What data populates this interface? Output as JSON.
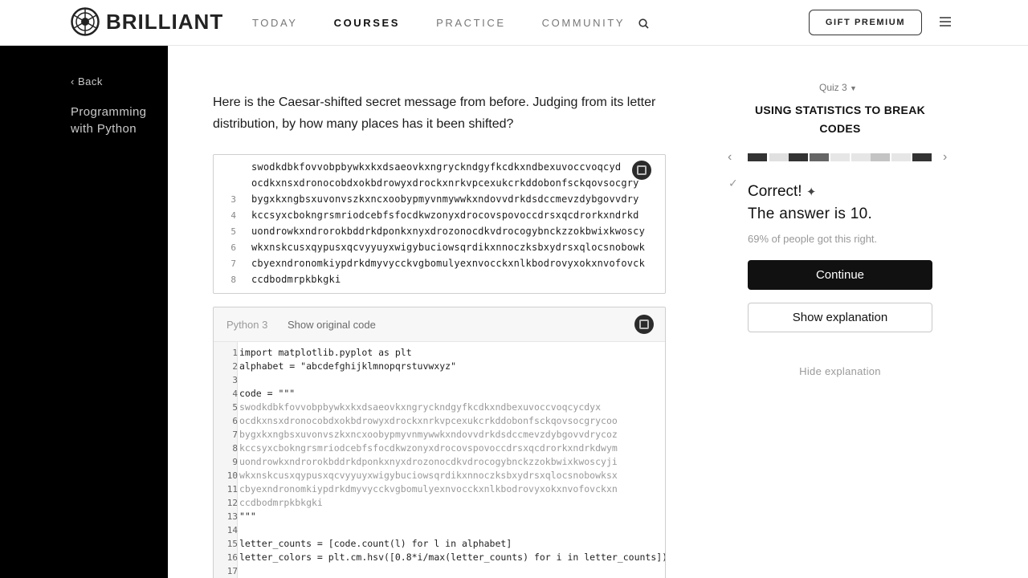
{
  "header": {
    "brand": "BRILLIANT",
    "nav": [
      "TODAY",
      "COURSES",
      "PRACTICE",
      "COMMUNITY"
    ],
    "active_nav": "COURSES",
    "search_placeholder": "",
    "gift_label": "GIFT PREMIUM",
    "icons": [
      "brilliant-logo-icon",
      "search-icon",
      "menu-icon"
    ]
  },
  "sidebar": {
    "back_label": "Back",
    "course_title": "Programming with Python"
  },
  "question": {
    "text": "Here is the Caesar-shifted secret message from before. Judging from its letter distribution, by how many places has it been shifted?"
  },
  "message_panel": {
    "lines": [
      {
        "n": "",
        "t": "swodkdbkfovvobpbywkxkxdsaeovkxngryckndgyfkcdkxndbexuvoccvoqcyd"
      },
      {
        "n": "",
        "t": "ocdkxnsxdronocobdxokbdrowyxdrockxnrkvpcexukcrkddobonfsckqovsocgry"
      },
      {
        "n": "3",
        "t": "bygxkxngbsxuvonvszkxncxoobypmyvnmywwkxndovvdrkdsdccmevzdybgovvdry"
      },
      {
        "n": "4",
        "t": "kccsyxcbokngrsmriodcebfsfocdkwzonyxdrocovspovoccdrsxqcdrorkxndrkd"
      },
      {
        "n": "5",
        "t": "uondrowkxndrorokbddrkdponkxnyxdrozonocdkvdrocogybnckzzokbwixkwoscy"
      },
      {
        "n": "6",
        "t": "wkxnskcusxqypusxqcvyyuyxwigybuciowsqrdikxnnoczksbxydrsxqlocsnobowk"
      },
      {
        "n": "7",
        "t": "cbyexndronomkiypdrkdmyvycckvgbomulyexnvocckxnlkbodrovyxokxnvofovck"
      },
      {
        "n": "8",
        "t": "ccdbodmrpkbkgki"
      }
    ]
  },
  "code_panel": {
    "language": "Python 3",
    "show_original": "Show original code",
    "lines": [
      {
        "n": "1",
        "t": "import matplotlib.pyplot as plt"
      },
      {
        "n": "2",
        "t": "alphabet = \"abcdefghijklmnopqrstuvwxyz\""
      },
      {
        "n": "3",
        "t": ""
      },
      {
        "n": "4",
        "t": "code = \"\"\""
      },
      {
        "n": "5",
        "t": "swodkdbkfovvobpbywkxkxdsaeovkxngryckndgyfkcdkxndbexuvoccvoqcycdyx"
      },
      {
        "n": "6",
        "t": "ocdkxnsxdronocobdxokbdrowyxdrockxnrkvpcexukcrkddobonfsckqovsocgrycoo"
      },
      {
        "n": "7",
        "t": "bygxkxngbsxuvonvszkxncxoobypmyvnmywwkxndovvdrkdsdccmevzdybgovvdrycoz"
      },
      {
        "n": "8",
        "t": "kccsyxcbokngrsmriodcebfsfocdkwzonyxdrocovspovoccdrsxqcdrorkxndrkdwym"
      },
      {
        "n": "9",
        "t": "uondrowkxndrorokbddrkdponkxnyxdrozonocdkvdrocogybnckzzokbwixkwoscyji"
      },
      {
        "n": "10",
        "t": "wkxnskcusxqypusxqcvyyuyxwigybuciowsqrdikxnnoczksbxydrsxqlocsnobowksx"
      },
      {
        "n": "11",
        "t": "cbyexndronomkiypdrkdmyvycckvgbomulyexnvocckxnlkbodrovyxokxnvofovckxn"
      },
      {
        "n": "12",
        "t": "ccdbodmrpkbkgki"
      },
      {
        "n": "13",
        "t": "\"\"\""
      },
      {
        "n": "14",
        "t": ""
      },
      {
        "n": "15",
        "t": "letter_counts = [code.count(l) for l in alphabet]"
      },
      {
        "n": "16",
        "t": "letter_colors = plt.cm.hsv([0.8*i/max(letter_counts) for i in letter_counts])"
      },
      {
        "n": "17",
        "t": ""
      }
    ]
  },
  "quiz": {
    "label": "Quiz 3",
    "title": "USING STATISTICS TO BREAK CODES",
    "feedback": "Correct!",
    "answer": "The answer is 10.",
    "stat": "69% of people got this right.",
    "continue_label": "Continue",
    "explain_label": "Show explanation",
    "hide_label": "Hide explanation"
  },
  "colors": {
    "sidebar_bg": "#000000",
    "primary_button": "#111111",
    "progress_done": "#333333",
    "progress_pending": "#cccccc"
  }
}
